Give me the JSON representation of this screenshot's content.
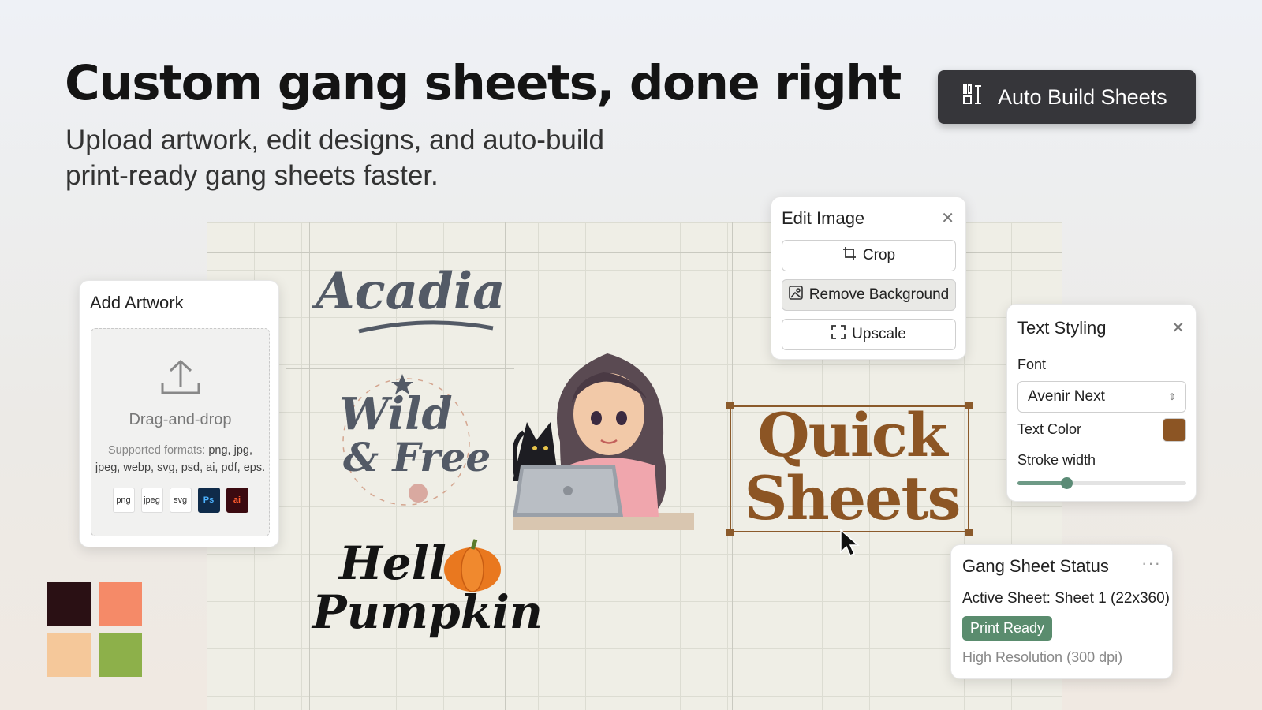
{
  "header": {
    "title": "Custom gang sheets, done right",
    "subtitle": "Upload artwork, edit designs, and auto-build print-ready gang sheets faster."
  },
  "auto_build_button": {
    "label": "Auto Build Sheets",
    "icon": "layout-grid-icon"
  },
  "add_artwork": {
    "title": "Add Artwork",
    "dropzone_label": "Drag-and-drop",
    "formats_prefix": "Supported formats:",
    "formats_list": "png, jpg, jpeg, webp, svg, psd, ai, pdf, eps.",
    "file_icons": [
      "png",
      "jpeg",
      "svg",
      "Ps",
      "ai"
    ]
  },
  "artworks": {
    "acadia": "Acadia",
    "wild_line1": "Wild",
    "wild_line2": "& Free",
    "hello_line1": "Hello",
    "hello_line2": "Pumpkin",
    "quick_line1": "Quick",
    "quick_line2": "Sheets"
  },
  "edit_image": {
    "title": "Edit Image",
    "buttons": [
      {
        "label": "Crop",
        "icon": "crop-icon"
      },
      {
        "label": "Remove Background",
        "icon": "remove-background-icon"
      },
      {
        "label": "Upscale",
        "icon": "upscale-icon"
      }
    ]
  },
  "text_styling": {
    "title": "Text Styling",
    "font_label": "Font",
    "font_value": "Avenir Next",
    "text_color_label": "Text Color",
    "text_color": "#8c5524",
    "stroke_label": "Stroke width",
    "stroke_value": 0.29
  },
  "gang_status": {
    "title": "Gang Sheet Status",
    "active_sheet": "Active Sheet: Sheet 1 (22x360)",
    "badge": "Print Ready",
    "resolution": "High Resolution (300 dpi)"
  },
  "palette": [
    "#2a1014",
    "#f58a68",
    "#f5c89a",
    "#8db04a"
  ],
  "colors": {
    "accent_green": "#5a8c6e",
    "brand_dark": "#36363a",
    "brown": "#8c5524"
  }
}
